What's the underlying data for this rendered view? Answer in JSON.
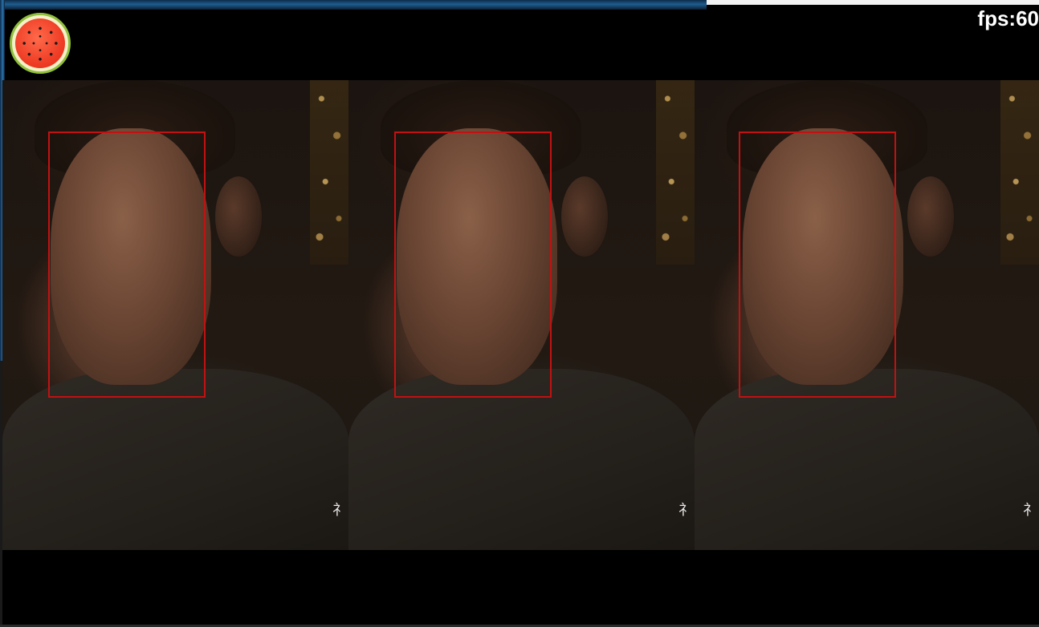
{
  "overlay": {
    "fps_text": "fps:60",
    "logo_icon": "watermelon-icon"
  },
  "video": {
    "panel_count": 3,
    "subtitle_fragment": "礻",
    "face_box_color": "#c01212"
  },
  "colors": {
    "background": "#000000",
    "fps_text": "#ffffff",
    "window_frame": "#1f5d8f"
  }
}
